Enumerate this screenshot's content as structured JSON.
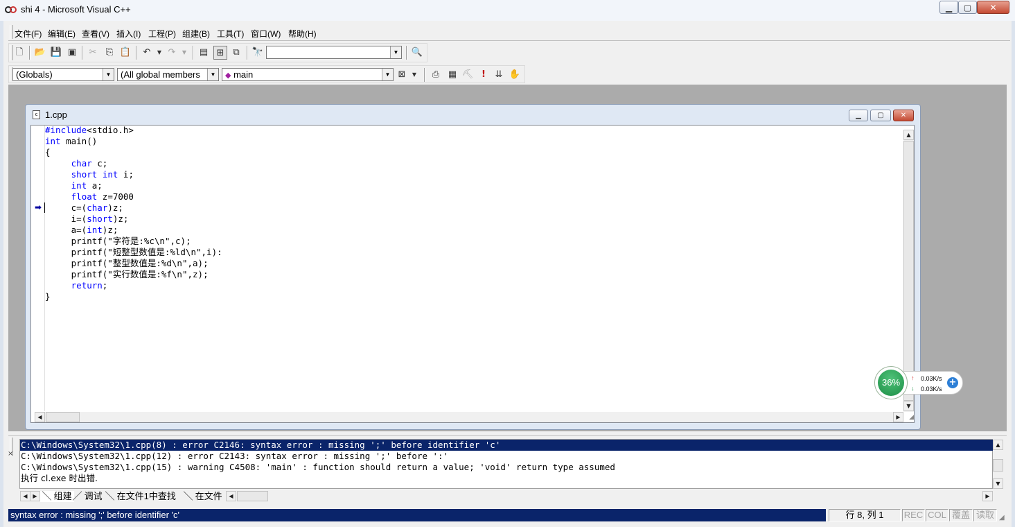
{
  "window": {
    "title": "shi 4 - Microsoft Visual C++"
  },
  "caption_buttons": {
    "minimize": "▁",
    "maximize": "▢",
    "close": "✕"
  },
  "menu": [
    "文件(F)",
    "编辑(E)",
    "查看(V)",
    "插入(I)",
    "工程(P)",
    "组建(B)",
    "工具(T)",
    "窗口(W)",
    "帮助(H)"
  ],
  "toolbar": {
    "find_combo_value": "",
    "scope_combo": "(Globals)",
    "members_combo": "(All global members",
    "function_combo": "main"
  },
  "document": {
    "title": "1.cpp",
    "code_lines": [
      "#include<stdio.h>",
      "int main()",
      "{",
      "     char c;",
      "     short int i;",
      "     int a;",
      "     float z=7000",
      "     c=(char)z;",
      "     i=(short)z;",
      "     a=(int)z;",
      "     printf(\"字符是:%c\\n\",c);",
      "     printf(\"短整型数值是:%ld\\n\",i):",
      "     printf(\"整型数值是:%d\\n\",a);",
      "     printf(\"实行数值是:%f\\n\",z);",
      "     return;",
      "}"
    ]
  },
  "output": {
    "lines": [
      "C:\\Windows\\System32\\1.cpp(8) : error C2146: syntax error : missing ';' before identifier 'c'",
      "C:\\Windows\\System32\\1.cpp(12) : error C2143: syntax error : missing ';' before ':'",
      "C:\\Windows\\System32\\1.cpp(15) : warning C4508: 'main' : function should return a value; 'void' return type assumed",
      "执行 cl.exe 时出错."
    ],
    "selected_line": 0,
    "tabs": [
      "组建",
      "调试",
      "在文件1中查找",
      "在文件"
    ]
  },
  "statusbar": {
    "message": "syntax error : missing ';' before identifier 'c'",
    "position": "行 8, 列 1",
    "indicators": [
      "REC",
      "COL",
      "覆盖",
      "读取"
    ]
  },
  "speed_widget": {
    "percent": "36%",
    "upload": "0.03K/s",
    "download": "0.03K/s",
    "up_color": "#d23030",
    "down_color": "#1c8e45"
  },
  "colors": {
    "keyword": "#0000ff",
    "selection": "#0a246a"
  }
}
